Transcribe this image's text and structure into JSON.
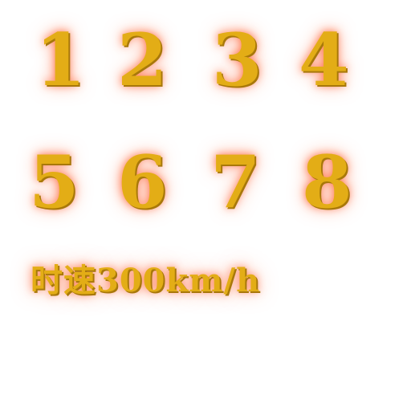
{
  "digits": {
    "row1": [
      "1",
      "2",
      "3",
      "4"
    ],
    "row2": [
      "5",
      "6",
      "7",
      "8"
    ]
  },
  "caption": "时速300km/h",
  "colors": {
    "gold": "#e3ad16",
    "shadow": "#a8780a",
    "glow": "#ff5a28"
  }
}
